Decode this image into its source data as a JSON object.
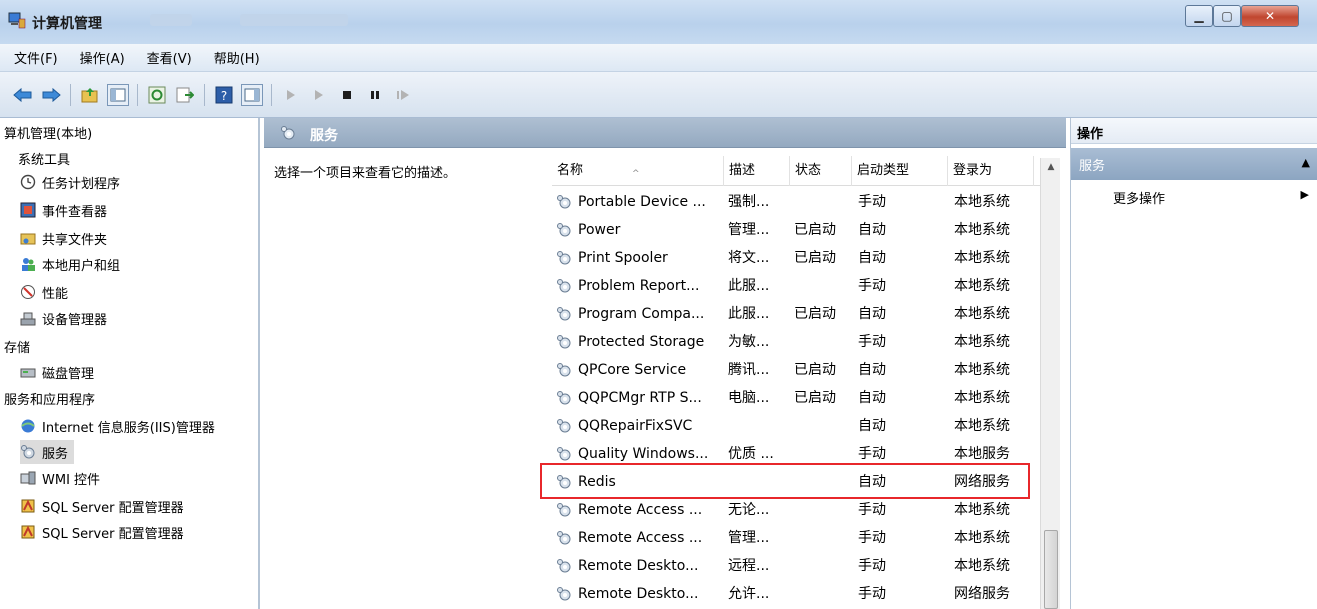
{
  "window": {
    "title": "计算机管理"
  },
  "menu": [
    "文件(F)",
    "操作(A)",
    "查看(V)",
    "帮助(H)"
  ],
  "toolbar": [
    "back-icon",
    "forward-icon",
    "up-folder-icon",
    "show-tree-icon",
    "refresh-icon",
    "export-icon",
    "help-icon",
    "properties-icon",
    "play-icon",
    "play-alt-icon",
    "stop-icon",
    "pause-icon",
    "restart-icon"
  ],
  "tree": [
    {
      "label": "算机管理(本地)",
      "icon": "",
      "x": 4
    },
    {
      "label": "系统工具",
      "icon": "",
      "x": 18
    },
    {
      "label": "任务计划程序",
      "icon": "clock-icon",
      "x": 20
    },
    {
      "label": "事件查看器",
      "icon": "event-viewer-icon",
      "x": 20
    },
    {
      "label": "共享文件夹",
      "icon": "shared-folder-icon",
      "x": 20
    },
    {
      "label": "本地用户和组",
      "icon": "users-icon",
      "x": 20
    },
    {
      "label": "性能",
      "icon": "performance-icon",
      "x": 20
    },
    {
      "label": "设备管理器",
      "icon": "device-manager-icon",
      "x": 20
    },
    {
      "label": "存储",
      "icon": "",
      "x": 4
    },
    {
      "label": "磁盘管理",
      "icon": "disk-icon",
      "x": 20
    },
    {
      "label": "服务和应用程序",
      "icon": "",
      "x": 4
    },
    {
      "label": "Internet 信息服务(IIS)管理器",
      "icon": "iis-icon",
      "x": 20
    },
    {
      "label": "服务",
      "icon": "services-icon",
      "x": 20,
      "selected": true
    },
    {
      "label": "WMI 控件",
      "icon": "wmi-icon",
      "x": 20
    },
    {
      "label": "SQL Server 配置管理器",
      "icon": "sql-icon",
      "x": 20
    },
    {
      "label": "SQL Server 配置管理器",
      "icon": "sql-icon",
      "x": 20
    }
  ],
  "middle": {
    "header": "服务",
    "description": "选择一个项目来查看它的描述。",
    "columns": [
      "名称",
      "描述",
      "状态",
      "启动类型",
      "登录为"
    ],
    "rows": [
      {
        "name": "Portable Device ...",
        "desc": "强制...",
        "status": "",
        "startup": "手动",
        "logon": "本地系统"
      },
      {
        "name": "Power",
        "desc": "管理...",
        "status": "已启动",
        "startup": "自动",
        "logon": "本地系统"
      },
      {
        "name": "Print Spooler",
        "desc": "将文...",
        "status": "已启动",
        "startup": "自动",
        "logon": "本地系统"
      },
      {
        "name": "Problem Report...",
        "desc": "此服...",
        "status": "",
        "startup": "手动",
        "logon": "本地系统"
      },
      {
        "name": "Program Compa...",
        "desc": "此服...",
        "status": "已启动",
        "startup": "自动",
        "logon": "本地系统"
      },
      {
        "name": "Protected Storage",
        "desc": "为敏...",
        "status": "",
        "startup": "手动",
        "logon": "本地系统"
      },
      {
        "name": "QPCore Service",
        "desc": "腾讯...",
        "status": "已启动",
        "startup": "自动",
        "logon": "本地系统"
      },
      {
        "name": "QQPCMgr RTP S...",
        "desc": "电脑...",
        "status": "已启动",
        "startup": "自动",
        "logon": "本地系统"
      },
      {
        "name": "QQRepairFixSVC",
        "desc": "",
        "status": "",
        "startup": "自动",
        "logon": "本地系统"
      },
      {
        "name": "Quality Windows...",
        "desc": "优质 ...",
        "status": "",
        "startup": "手动",
        "logon": "本地服务"
      },
      {
        "name": "Redis",
        "desc": "",
        "status": "",
        "startup": "自动",
        "logon": "网络服务"
      },
      {
        "name": "Remote Access ...",
        "desc": "无论...",
        "status": "",
        "startup": "手动",
        "logon": "本地系统"
      },
      {
        "name": "Remote Access ...",
        "desc": "管理...",
        "status": "",
        "startup": "手动",
        "logon": "本地系统"
      },
      {
        "name": "Remote Deskto...",
        "desc": "远程...",
        "status": "",
        "startup": "手动",
        "logon": "本地系统"
      },
      {
        "name": "Remote Deskto...",
        "desc": "允许...",
        "status": "",
        "startup": "手动",
        "logon": "网络服务"
      }
    ]
  },
  "actions": {
    "header": "操作",
    "section": "服务",
    "item": "更多操作"
  }
}
